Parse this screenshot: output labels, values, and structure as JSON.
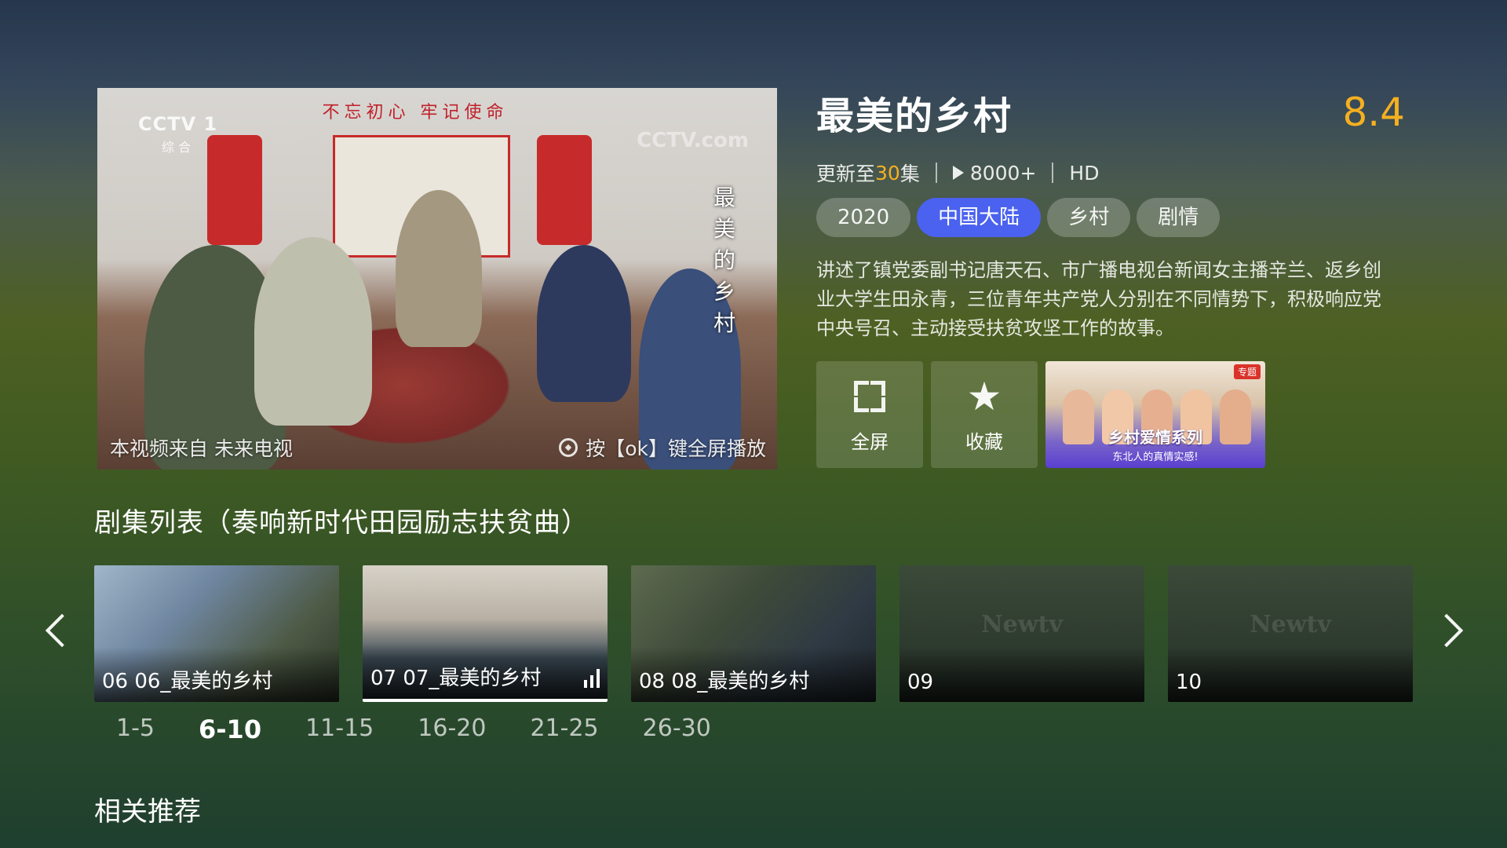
{
  "player": {
    "channel_logo": "CCTV 1",
    "channel_sub": "综 合",
    "banner_text": "不忘初心 牢记使命",
    "watermark": "CCTV.com",
    "vertical_title": "最美的乡村",
    "source_text": "本视频来自 未来电视",
    "fullscreen_hint": "按【ok】键全屏播放"
  },
  "detail": {
    "title": "最美的乡村",
    "rating": "8.4",
    "update_prefix": "更新至",
    "update_count": "30",
    "update_suffix": "集",
    "play_count": "8000+",
    "quality": "HD",
    "tags": [
      {
        "label": "2020"
      },
      {
        "label": "中国大陆"
      },
      {
        "label": "乡村"
      },
      {
        "label": "剧情"
      }
    ],
    "description": "讲述了镇党委副书记唐天石、市广播电视台新闻女主播辛兰、返乡创业大学生田永青，三位青年共产党人分别在不同情势下，积极响应党中央号召、主动接受扶贫攻坚工作的故事。"
  },
  "actions": {
    "fullscreen_label": "全屏",
    "favorite_label": "收藏",
    "promo_title": "乡村爱情系列",
    "promo_subtitle": "东北人的真情实感!",
    "promo_badge": "专题"
  },
  "episodes": {
    "section_title": "剧集列表（奏响新时代田园励志扶贫曲）",
    "items": [
      {
        "label": "06 06_最美的乡村"
      },
      {
        "label": "07 07_最美的乡村"
      },
      {
        "label": "08 08_最美的乡村"
      },
      {
        "label": "09",
        "watermark": "Newtv"
      },
      {
        "label": "10",
        "watermark": "Newtv"
      }
    ],
    "ranges": [
      "1-5",
      "6-10",
      "11-15",
      "16-20",
      "21-25",
      "26-30"
    ]
  },
  "recommend": {
    "title": "相关推荐"
  },
  "colors": {
    "accent_blue": "#4a62ef",
    "rating_gold": "#f5b020"
  }
}
